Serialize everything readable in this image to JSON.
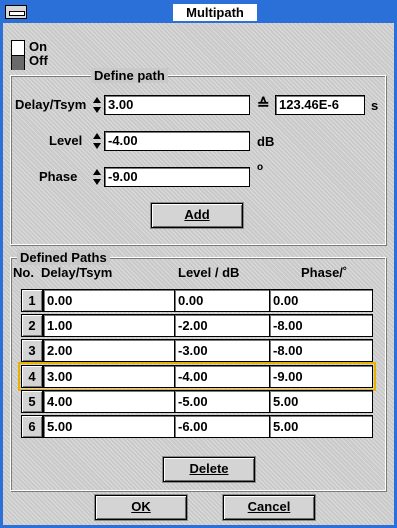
{
  "window": {
    "title": "Multipath"
  },
  "switch": {
    "on_label": "On",
    "off_label": "Off"
  },
  "define_path": {
    "group_title": "Define path",
    "delay_label": "Delay/Tsym",
    "delay_value": "3.00",
    "equiv_symbol": "≙",
    "delay_seconds": "123.46E-6",
    "seconds_unit": "s",
    "level_label": "Level",
    "level_value": "-4.00",
    "level_unit": "dB",
    "phase_label": "Phase",
    "phase_value": "-9.00",
    "phase_unit": "o",
    "add_label": "Add"
  },
  "defined_paths": {
    "group_title": "Defined Paths",
    "columns": [
      "No.",
      "Delay/Tsym",
      "Level / dB",
      "Phase/˚"
    ],
    "rows": [
      {
        "no": "1",
        "delay": "0.00",
        "level": "0.00",
        "phase": "0.00"
      },
      {
        "no": "2",
        "delay": "1.00",
        "level": "-2.00",
        "phase": "-8.00"
      },
      {
        "no": "3",
        "delay": "2.00",
        "level": "-3.00",
        "phase": "-8.00"
      },
      {
        "no": "4",
        "delay": "3.00",
        "level": "-4.00",
        "phase": "-9.00"
      },
      {
        "no": "5",
        "delay": "4.00",
        "level": "-5.00",
        "phase": "5.00"
      },
      {
        "no": "6",
        "delay": "5.00",
        "level": "-6.00",
        "phase": "5.00"
      }
    ],
    "selected_row": "4",
    "delete_label": "Delete"
  },
  "footer": {
    "ok_label": "OK",
    "cancel_label": "Cancel"
  },
  "colors": {
    "titlebar": "#2b6fd8",
    "selection": "#e6b400"
  }
}
